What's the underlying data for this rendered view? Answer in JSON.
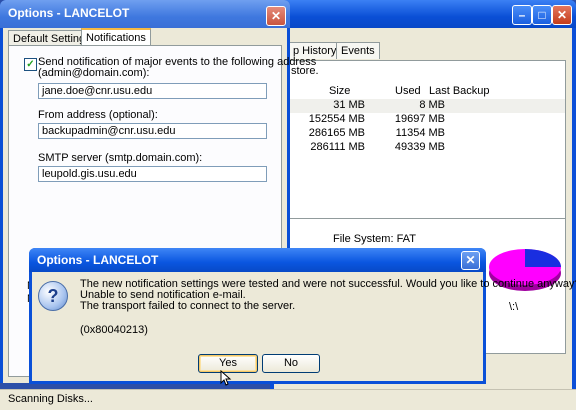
{
  "main_window": {
    "tabs": [
      "p History",
      "Events"
    ],
    "store_text": "store.",
    "columns": [
      "Size",
      "Used",
      "Last Backup"
    ],
    "rows": [
      {
        "size": "31 MB",
        "used": "8 MB",
        "last_backup": ""
      },
      {
        "size": "152554 MB",
        "used": "19697 MB",
        "last_backup": ""
      },
      {
        "size": "286165 MB",
        "used": "11354 MB",
        "last_backup": ""
      },
      {
        "size": "286111 MB",
        "used": "49339 MB",
        "last_backup": ""
      }
    ],
    "file_system": "File System: FAT",
    "drive_label": "\\:\\"
  },
  "options": {
    "title": "Options - LANCELOT",
    "tabs": [
      "Default Settings",
      "Notifications"
    ],
    "checkbox_label_1": "Send notification of major events to the following address",
    "checkbox_label_2": "(admin@domain.com):",
    "address_value": "jane.doe@cnr.usu.edu",
    "from_label": "From address (optional):",
    "from_value": "backupadmin@cnr.usu.edu",
    "smtp_label": "SMTP server (smtp.domain.com):",
    "smtp_value": "leupold.gis.usu.edu",
    "n_fragment": "N",
    "m_fragment": "M"
  },
  "dialog": {
    "title": "Options - LANCELOT",
    "line1": "The new notification settings were tested and were not successful. Would you like to continue anyway?",
    "line2": "Unable to send notification e-mail.",
    "line3": "The transport failed to connect to the server.",
    "code": "(0x80040213)",
    "yes": "Yes",
    "no": "No"
  },
  "status": "Scanning Disks..."
}
